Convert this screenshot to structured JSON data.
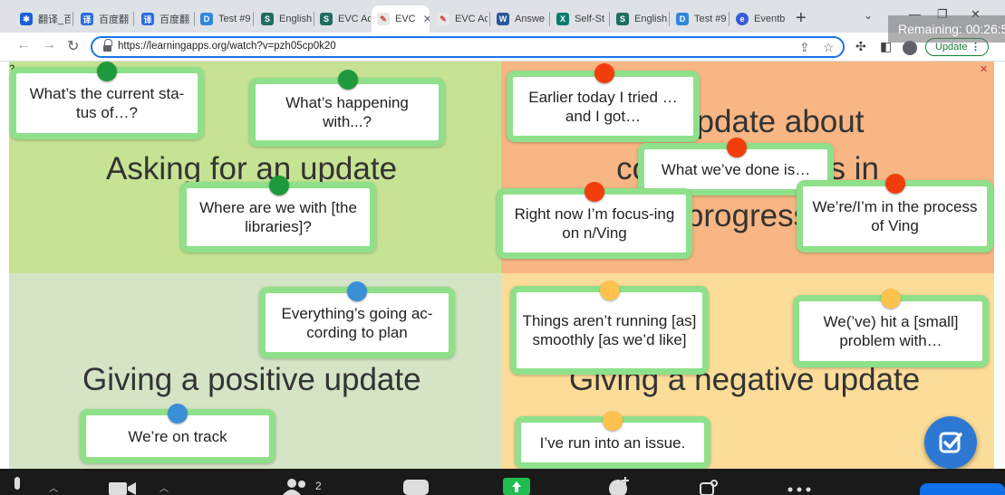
{
  "browser": {
    "tabs": [
      {
        "title": "翻译_百",
        "icon_color": "#1a5fd6",
        "icon": "baidu-translate-icon",
        "active": false
      },
      {
        "title": "百度翻",
        "icon_color": "#2b6de0",
        "icon": "baidu-translate-icon",
        "active": false
      },
      {
        "title": "百度翻",
        "icon_color": "#2b6de0",
        "icon": "baidu-translate-icon",
        "active": false
      },
      {
        "title": "Test #9",
        "icon_color": "#2f88d8",
        "icon": "test-site-icon",
        "active": false
      },
      {
        "title": "English",
        "icon_color": "#1f6e5f",
        "icon": "sharepoint-icon",
        "active": false
      },
      {
        "title": "EVC Ac",
        "icon_color": "#1f6e5f",
        "icon": "sharepoint-icon",
        "active": false
      },
      {
        "title": "EVC",
        "icon_color": "#e8e8e8",
        "icon": "learningapps-icon",
        "active": true
      },
      {
        "title": "EVC Ac",
        "icon_color": "#e8e8e8",
        "icon": "learningapps-icon",
        "active": false
      },
      {
        "title": "Answe",
        "icon_color": "#2b579a",
        "icon": "word-icon",
        "active": false
      },
      {
        "title": "Self-St",
        "icon_color": "#0b7b6e",
        "icon": "excel-icon",
        "active": false
      },
      {
        "title": "English",
        "icon_color": "#1f6e5f",
        "icon": "sharepoint-icon",
        "active": false
      },
      {
        "title": "Test #9",
        "icon_color": "#2f88d8",
        "icon": "test-site-icon",
        "active": false
      },
      {
        "title": "Eventb",
        "icon_color": "#3b5bdb",
        "icon": "eventbrite-icon",
        "active": false
      }
    ],
    "url": "https://learningapps.org/watch?v=pzh05cp0k20",
    "update_label": "Update",
    "remaining_label": "Remaining: 00:26:5"
  },
  "app": {
    "quadrants": {
      "top_left": {
        "title": "Asking for an update",
        "color": "#c6e394"
      },
      "top_right": {
        "title_line1": "An update about",
        "title_line2": "completed tasks in",
        "title_line3": "progress",
        "color": "#f7b683"
      },
      "bottom_left": {
        "title": "Giving a positive update",
        "color": "#d5e4c5"
      },
      "bottom_right": {
        "title": "Giving a negative update",
        "color": "#fbdc98"
      }
    },
    "cards": [
      {
        "text": "What’s the current sta-tus of…?",
        "pin": "green"
      },
      {
        "text": "What’s happening with...?",
        "pin": "green"
      },
      {
        "text": "Where are we with [the libraries]?",
        "pin": "green"
      },
      {
        "text": "Earlier today I tried … and I got…",
        "pin": "red"
      },
      {
        "text": "What we’ve done is…",
        "pin": "red"
      },
      {
        "text": "Right now I’m focus-ing on n/Ving",
        "pin": "red"
      },
      {
        "text": "We’re/I’m in the process of Ving",
        "pin": "red"
      },
      {
        "text": "Everything’s going ac-cording to plan",
        "pin": "blue"
      },
      {
        "text": "We’re on track",
        "pin": "blue"
      },
      {
        "text": "Things aren’t running [as] smoothly [as we’d like]",
        "pin": "yellow"
      },
      {
        "text": "We(’ve) hit a [small] problem with…",
        "pin": "yellow"
      },
      {
        "text": "I’ve run into an issue.",
        "pin": "yellow"
      }
    ]
  },
  "zoom": {
    "participants_count": "2"
  }
}
